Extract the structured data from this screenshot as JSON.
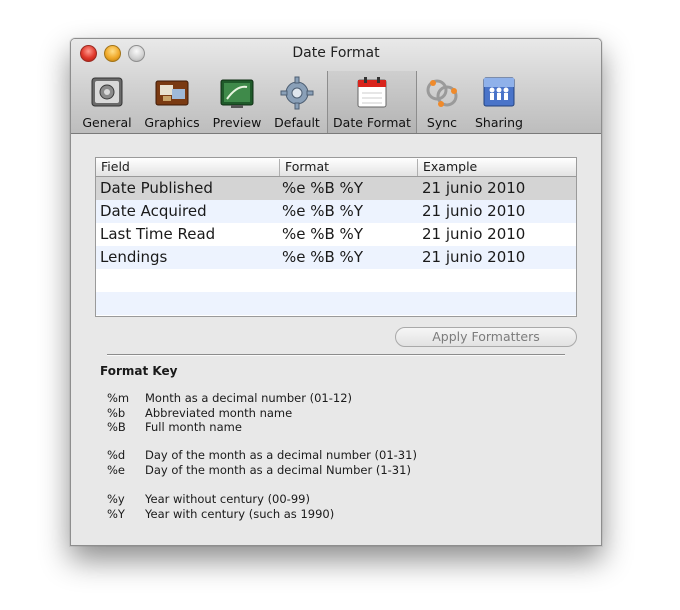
{
  "window": {
    "title": "Date Format"
  },
  "toolbar": {
    "items": [
      {
        "label": "General",
        "icon": "general-icon"
      },
      {
        "label": "Graphics",
        "icon": "graphics-icon"
      },
      {
        "label": "Preview",
        "icon": "preview-icon"
      },
      {
        "label": "Default",
        "icon": "gear-icon"
      },
      {
        "label": "Date Format",
        "icon": "calendar-icon",
        "selected": true
      },
      {
        "label": "Sync",
        "icon": "sync-icon"
      },
      {
        "label": "Sharing",
        "icon": "sharing-icon"
      }
    ]
  },
  "table": {
    "headers": [
      "Field",
      "Format",
      "Example"
    ],
    "rows": [
      {
        "field": "Date Published",
        "format": "%e %B %Y",
        "example": "21 junio 2010",
        "selected": true
      },
      {
        "field": "Date Acquired",
        "format": "%e %B %Y",
        "example": "21 junio 2010"
      },
      {
        "field": "Last Time Read",
        "format": "%e %B %Y",
        "example": "21 junio 2010"
      },
      {
        "field": "Lendings",
        "format": "%e %B %Y",
        "example": "21 junio 2010"
      }
    ]
  },
  "apply_button": {
    "label": "Apply Formatters"
  },
  "format_key": {
    "title": "Format Key",
    "entries": [
      {
        "code": "%m",
        "desc": "Month as a decimal number (01-12)"
      },
      {
        "code": "%b",
        "desc": "Abbreviated month name"
      },
      {
        "code": "%B",
        "desc": "Full month name"
      },
      {
        "code": "%d",
        "desc": "Day of the month as a decimal number (01-31)"
      },
      {
        "code": "%e",
        "desc": "Day of the month as a decimal Number (1-31)"
      },
      {
        "code": "%y",
        "desc": "Year without century (00-99)"
      },
      {
        "code": "%Y",
        "desc": "Year with century (such as 1990)"
      }
    ]
  },
  "colors": {
    "selected_row": "#d4d4d4",
    "alt_row": "#edf3fe"
  }
}
